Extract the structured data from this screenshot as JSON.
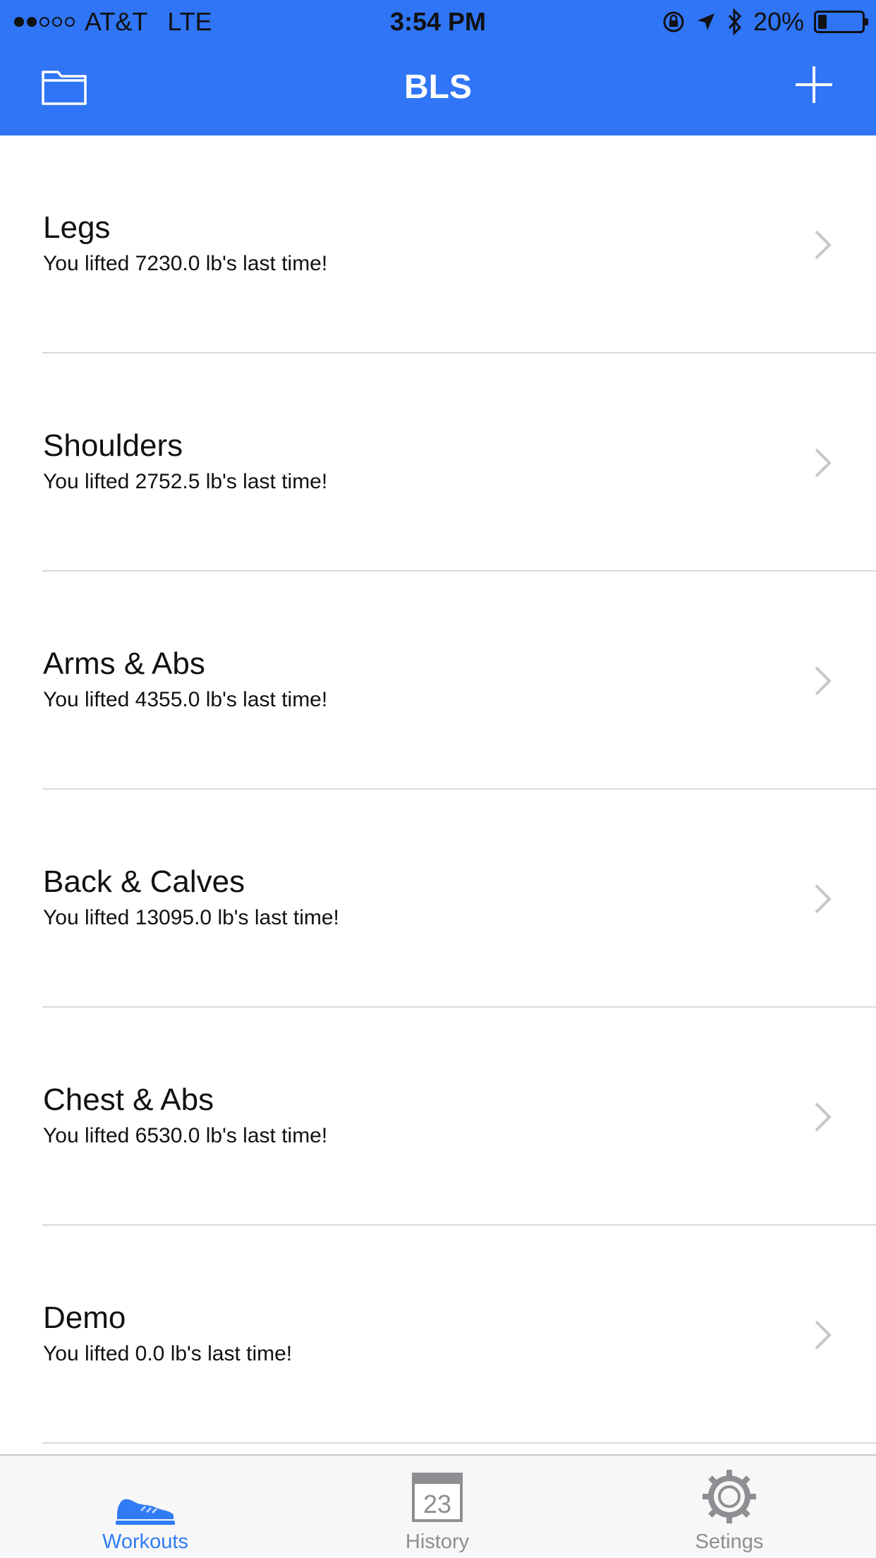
{
  "status_bar": {
    "carrier": "AT&T",
    "network": "LTE",
    "time": "3:54 PM",
    "battery": "20%",
    "battery_level": 0.2
  },
  "nav": {
    "title": "BLS",
    "left_icon": "folder-icon",
    "right_icon": "plus-icon"
  },
  "workouts": [
    {
      "name": "Legs",
      "subtitle": "You lifted 7230.0 lb's last time!"
    },
    {
      "name": "Shoulders",
      "subtitle": "You lifted 2752.5 lb's last time!"
    },
    {
      "name": "Arms & Abs",
      "subtitle": "You lifted 4355.0 lb's last time!"
    },
    {
      "name": "Back & Calves",
      "subtitle": "You lifted 13095.0 lb's last time!"
    },
    {
      "name": "Chest & Abs",
      "subtitle": "You lifted 6530.0 lb's last time!"
    },
    {
      "name": "Demo",
      "subtitle": "You lifted 0.0 lb's last time!"
    }
  ],
  "tabs": [
    {
      "label": "Workouts",
      "icon": "sneaker-icon",
      "active": true
    },
    {
      "label": "History",
      "icon": "calendar-icon",
      "calendar_day": "23",
      "active": false
    },
    {
      "label": "Setings",
      "icon": "gear-icon",
      "active": false
    }
  ],
  "colors": {
    "brand": "#2f75f6",
    "active_tab": "#2f7cf6",
    "inactive_tab": "#8e8e93"
  }
}
